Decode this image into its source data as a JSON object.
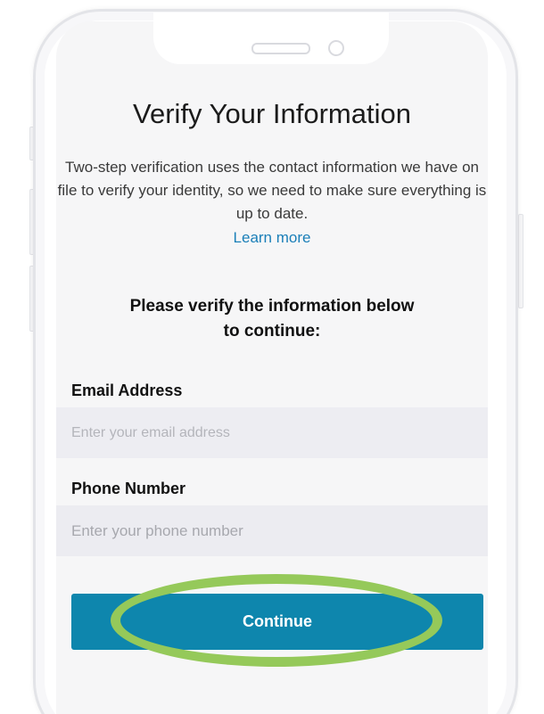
{
  "header": {
    "title": "Verify Your Information",
    "description": "Two-step verification uses the contact information we have on file to verify your identity, so we need to make sure everything is up to date.",
    "learn_more": "Learn more"
  },
  "prompt": {
    "line1": "Please verify the information below",
    "line2": "to continue:"
  },
  "form": {
    "email_label": "Email Address",
    "email_value": "",
    "email_placeholder": "Enter your email address",
    "phone_label": "Phone Number",
    "phone_value": "",
    "phone_placeholder": "Enter your phone number",
    "continue_label": "Continue"
  },
  "colors": {
    "accent": "#0e86ad",
    "link": "#1a7fb8",
    "highlight": "#95c95a",
    "field_background": "#ececf1"
  }
}
